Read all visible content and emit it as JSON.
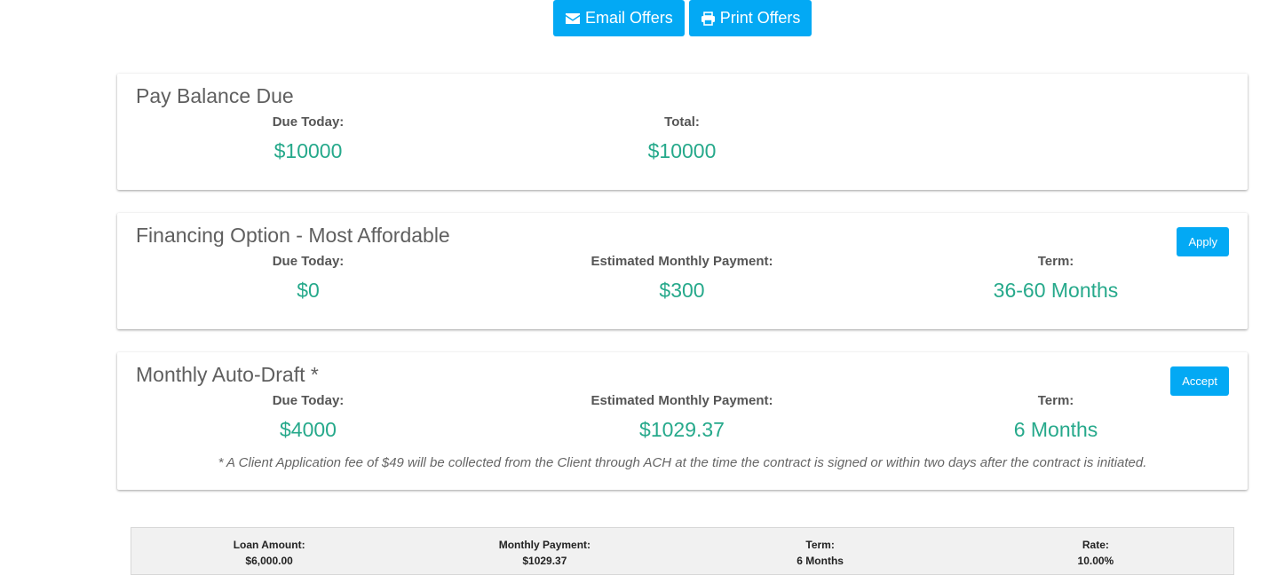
{
  "toolbar": {
    "email_label": "Email Offers",
    "print_label": "Print Offers",
    "email_icon": "envelope-icon",
    "print_icon": "printer-icon"
  },
  "pay_balance": {
    "title": "Pay Balance Due",
    "due_today_label": "Due Today:",
    "due_today_value": "$10000",
    "total_label": "Total:",
    "total_value": "$10000"
  },
  "financing": {
    "title": "Financing Option - Most Affordable",
    "button_label": "Apply",
    "due_today_label": "Due Today:",
    "due_today_value": "$0",
    "monthly_label": "Estimated Monthly Payment:",
    "monthly_value": "$300",
    "term_label": "Term:",
    "term_value": "36-60 Months"
  },
  "auto_draft": {
    "title": "Monthly Auto-Draft *",
    "button_label": "Accept",
    "due_today_label": "Due Today:",
    "due_today_value": "$4000",
    "monthly_label": "Estimated Monthly Payment:",
    "monthly_value": "$1029.37",
    "term_label": "Term:",
    "term_value": "6 Months",
    "footnote": "* A Client Application fee of $49 will be collected from the Client through ACH at the time the contract is signed or within two days after the contract is initiated."
  },
  "summary": {
    "loan_amount_label": "Loan Amount:",
    "loan_amount_value": "$6,000.00",
    "monthly_payment_label": "Monthly Payment:",
    "monthly_payment_value": "$1029.37",
    "term_label": "Term:",
    "term_value": "6 Months",
    "rate_label": "Rate:",
    "rate_value": "10.00%"
  },
  "colors": {
    "accent": "#03a9f4",
    "value_green": "#26a98b",
    "text_gray": "#555555"
  }
}
